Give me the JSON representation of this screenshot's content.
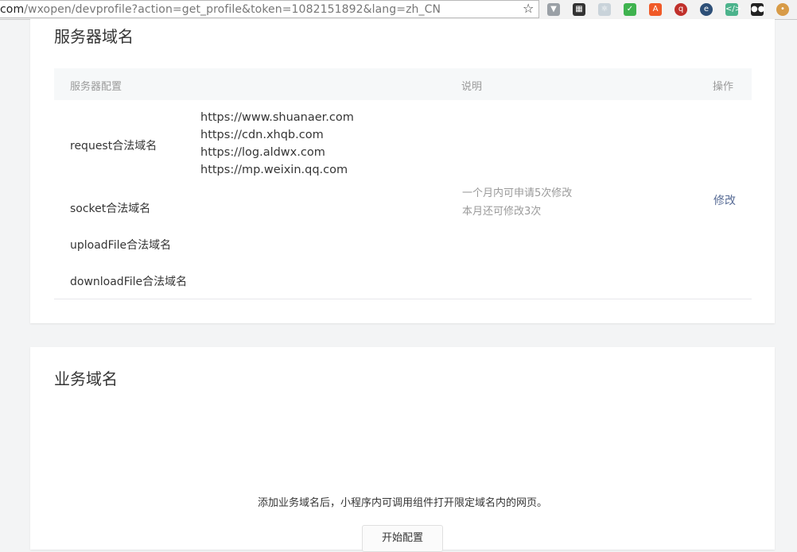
{
  "browser": {
    "url_prefix": "com",
    "url_path": "/wxopen/devprofile?action=get_profile&token=1082151892&lang=zh_CN"
  },
  "server_section": {
    "title": "服务器域名",
    "columns": {
      "config": "服务器配置",
      "desc": "说明",
      "op": "操作"
    },
    "rows": [
      {
        "label": "request合法域名"
      },
      {
        "label": "socket合法域名"
      },
      {
        "label": "uploadFile合法域名"
      },
      {
        "label": "downloadFile合法域名"
      }
    ],
    "request_domains": [
      "https://www.shuanaer.com",
      "https://cdn.xhqb.com",
      "https://log.aldwx.com",
      "https://mp.weixin.qq.com"
    ],
    "desc_lines": [
      "一个月内可申请5次修改",
      "本月还可修改3次"
    ],
    "modify_label": "修改"
  },
  "business_section": {
    "title": "业务域名",
    "hint": "添加业务域名后，小程序内可调用组件打开限定域名内的网页。",
    "button_label": "开始配置"
  }
}
